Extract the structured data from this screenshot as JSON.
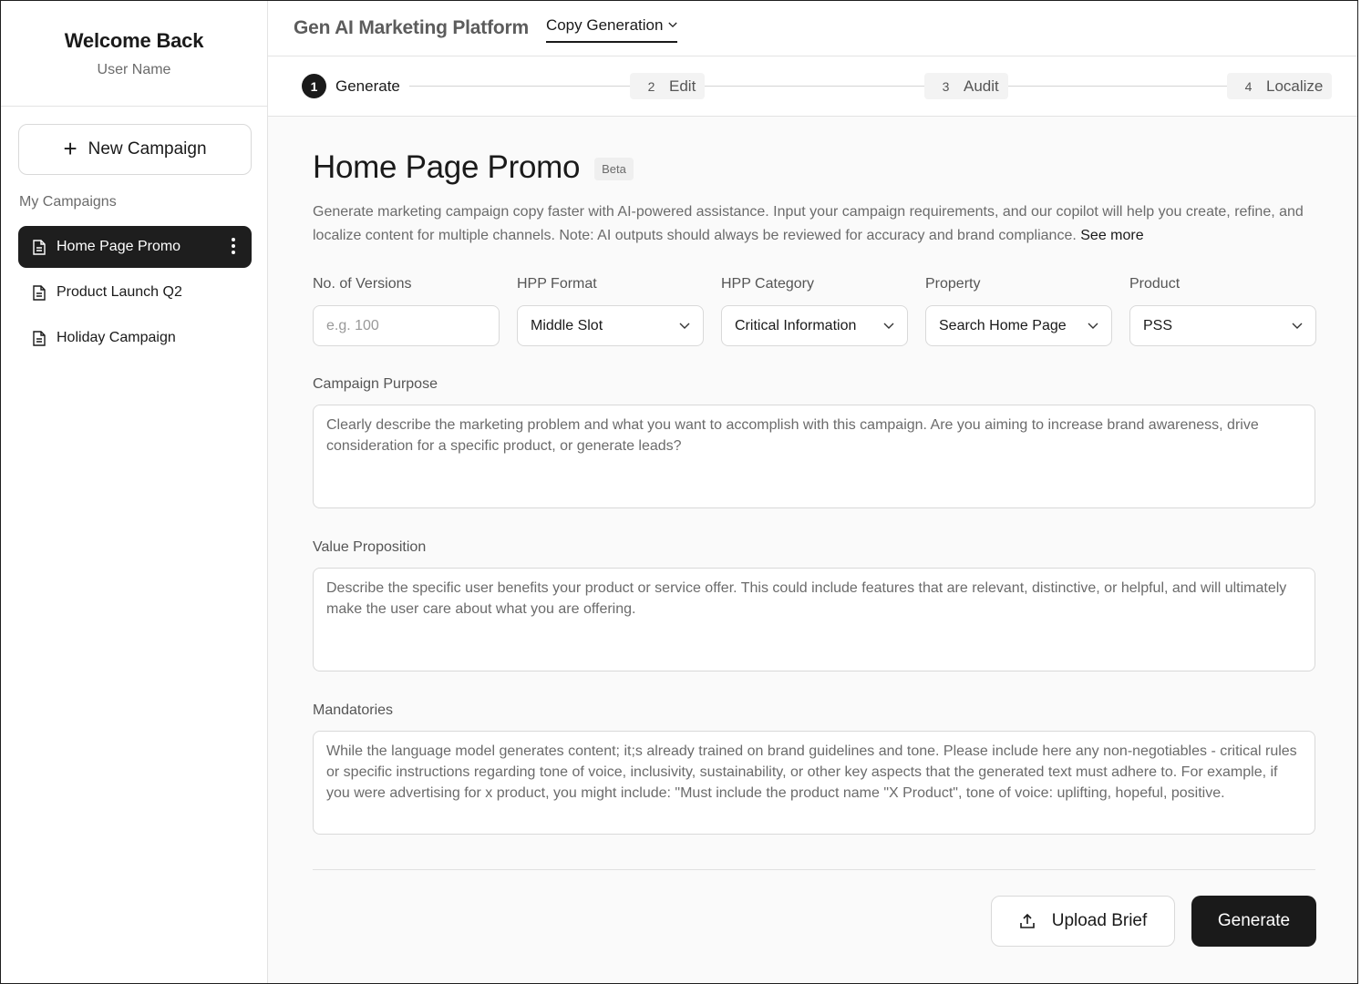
{
  "sidebar": {
    "welcome": "Welcome Back",
    "user_name": "User Name",
    "new_campaign_label": "New Campaign",
    "section_label": "My Campaigns",
    "campaigns": [
      {
        "label": "Home Page Promo",
        "active": true
      },
      {
        "label": "Product Launch Q2",
        "active": false
      },
      {
        "label": "Holiday Campaign",
        "active": false
      }
    ]
  },
  "header": {
    "app_title": "Gen AI Marketing Platform",
    "mode": "Copy Generation"
  },
  "steps": [
    {
      "num": "1",
      "label": "Generate",
      "active": true
    },
    {
      "num": "2",
      "label": "Edit",
      "active": false
    },
    {
      "num": "3",
      "label": "Audit",
      "active": false
    },
    {
      "num": "4",
      "label": "Localize",
      "active": false
    }
  ],
  "page": {
    "title": "Home Page Promo",
    "badge": "Beta",
    "description": "Generate marketing campaign copy faster with AI-powered assistance. Input your campaign requirements, and our copilot will help you create, refine, and localize content for multiple channels. Note: AI outputs should always be reviewed for accuracy and brand compliance.",
    "see_more": "See more"
  },
  "fields": {
    "versions": {
      "label": "No. of Versions",
      "placeholder": "e.g. 100"
    },
    "hpp_format": {
      "label": "HPP Format",
      "value": "Middle Slot"
    },
    "hpp_category": {
      "label": "HPP Category",
      "value": "Critical Information"
    },
    "property": {
      "label": "Property",
      "value": "Search Home Page"
    },
    "product": {
      "label": "Product",
      "value": "PSS"
    }
  },
  "textareas": {
    "purpose": {
      "label": "Campaign Purpose",
      "placeholder": "Clearly describe the marketing problem and what you want to accomplish with this campaign. Are you aiming to increase brand awareness, drive consideration for a specific product, or generate leads?"
    },
    "value_prop": {
      "label": "Value Proposition",
      "placeholder": "Describe the specific user benefits your product or service offer. This could include features that are relevant, distinctive, or helpful, and will ultimately make the user care about what you are offering."
    },
    "mandatories": {
      "label": "Mandatories",
      "placeholder": "While the language model generates content; it;s already trained on brand guidelines and tone. Please include here any non-negotiables - critical rules or specific instructions regarding tone of voice, inclusivity, sustainability, or other key aspects that the generated text must adhere to. For example, if you were advertising for x product, you might include: \"Must include the product name \"X Product\", tone of voice: uplifting, hopeful, positive."
    }
  },
  "actions": {
    "upload_label": "Upload Brief",
    "generate_label": "Generate"
  },
  "colors": {
    "accent": "#1a1a1a",
    "muted_text": "#6b6b6b",
    "border": "#d9d9d9"
  }
}
